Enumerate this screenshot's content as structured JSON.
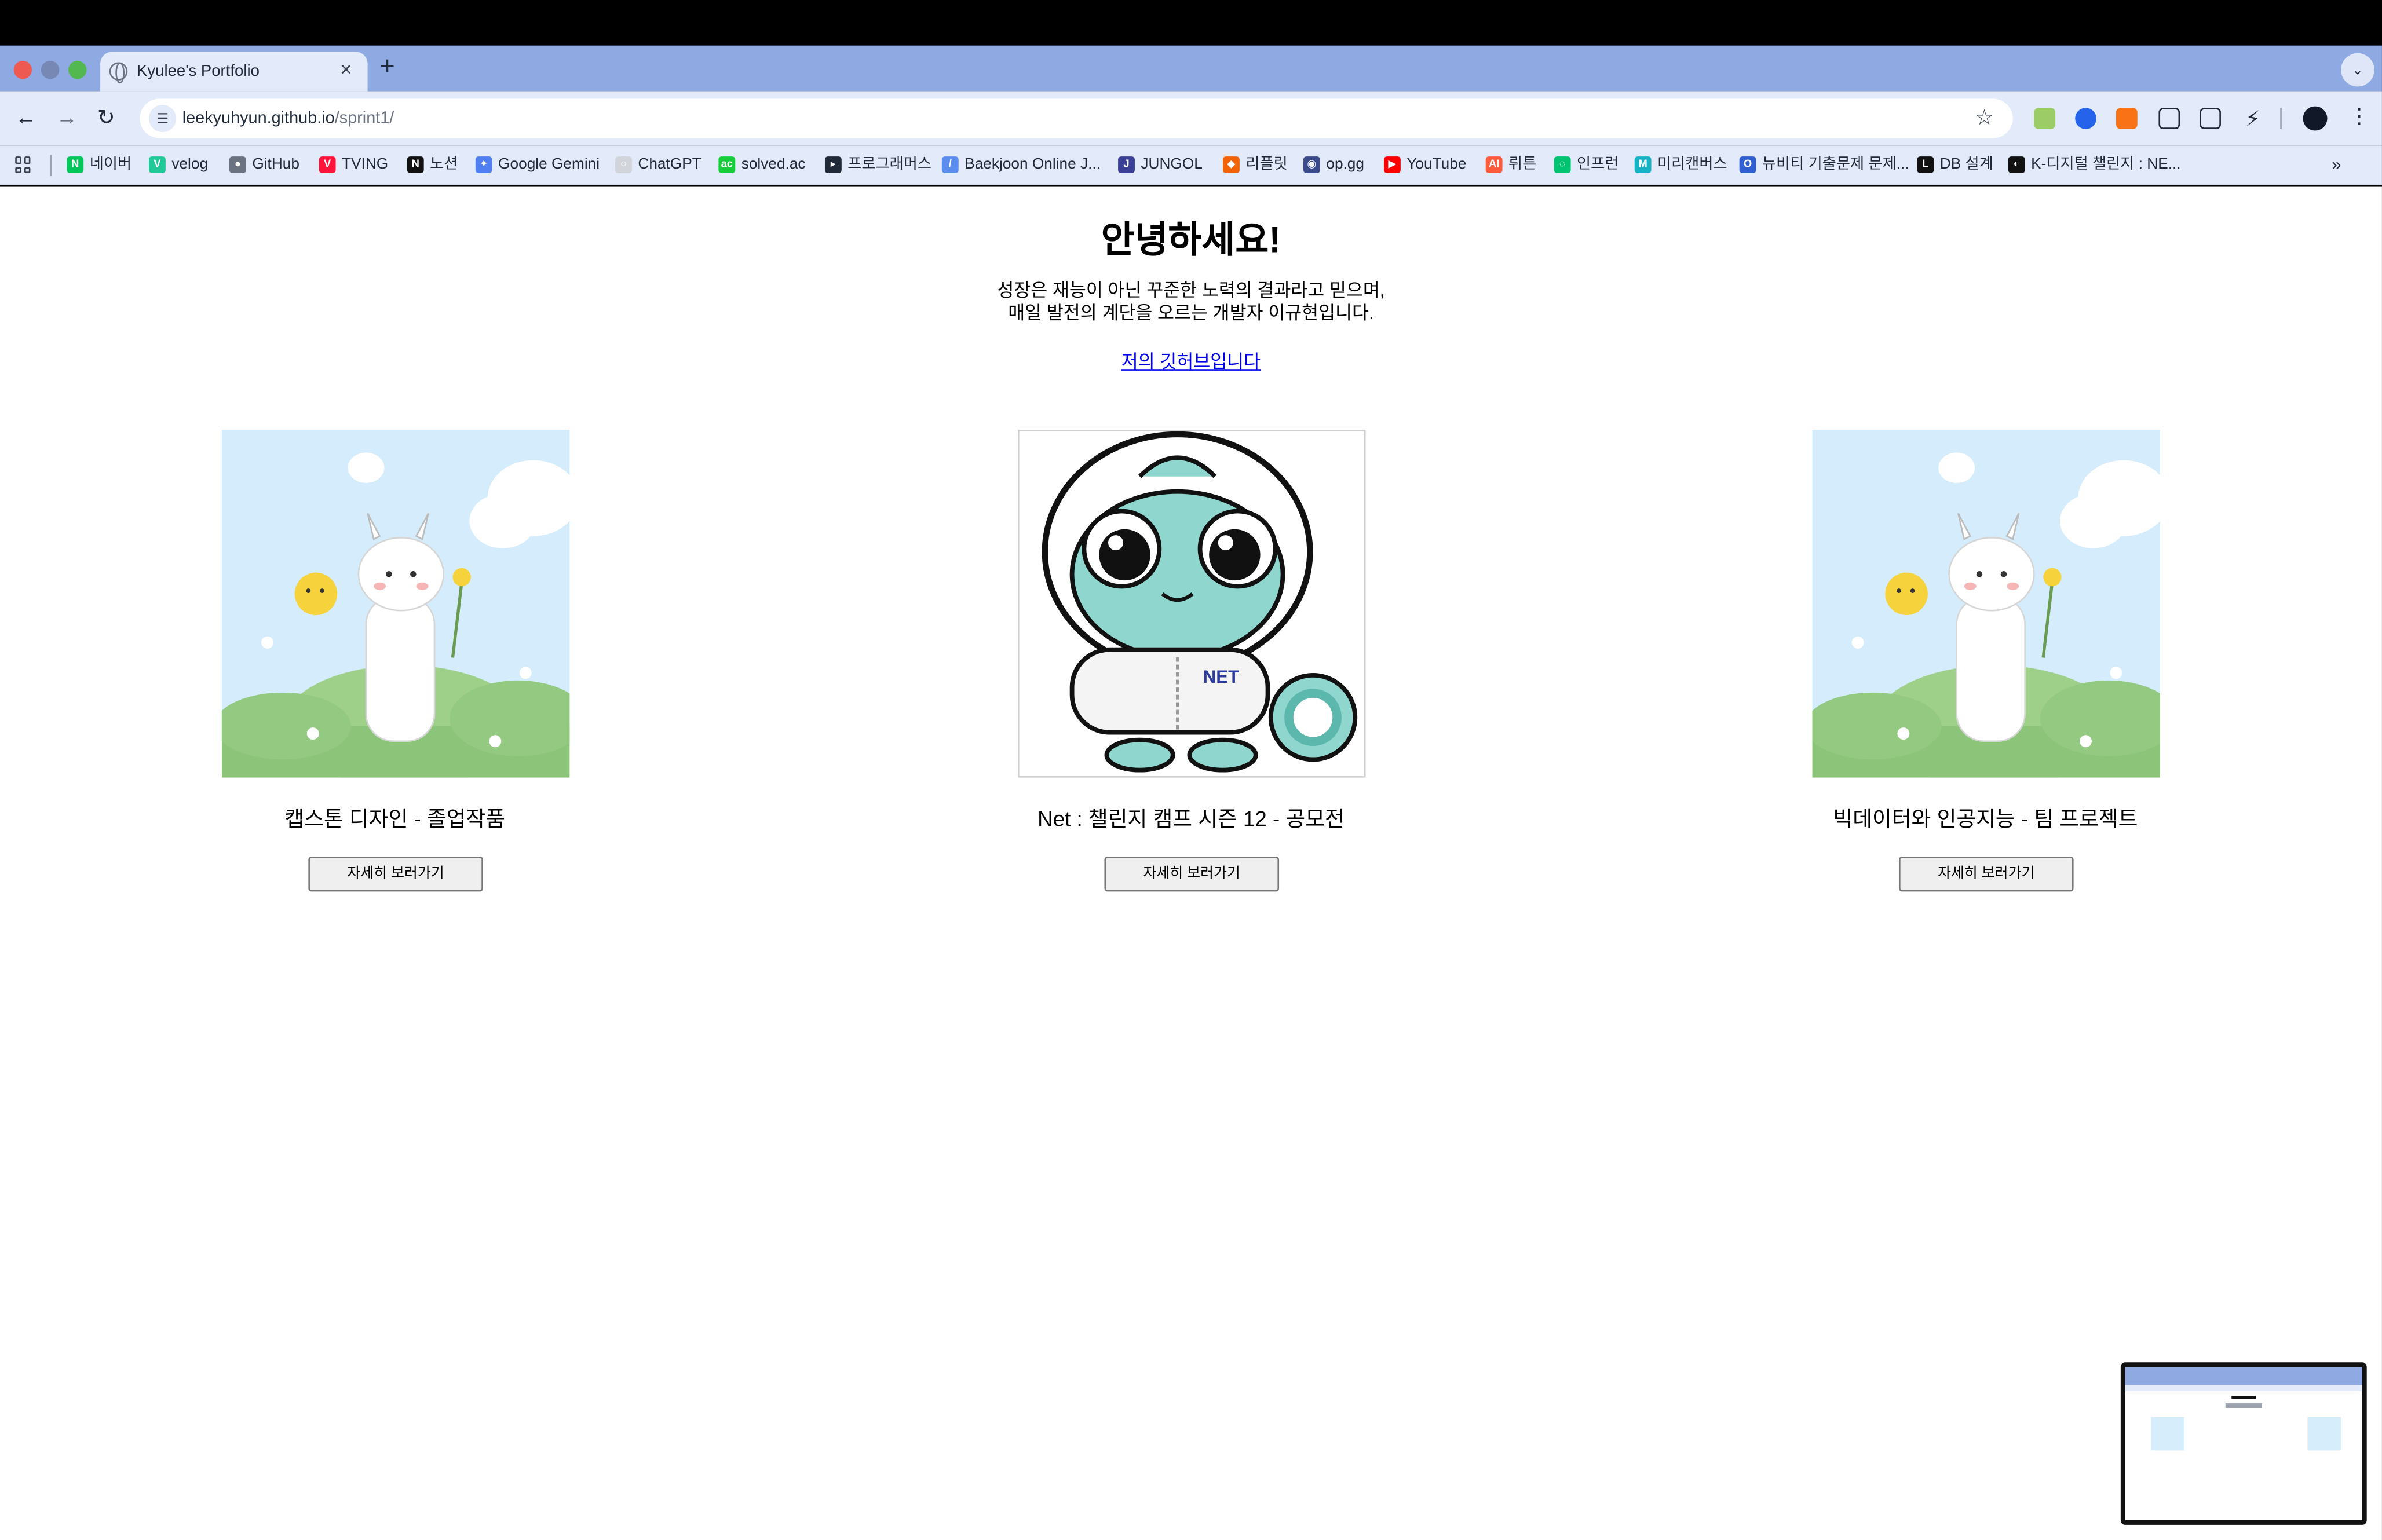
{
  "browser": {
    "tab_title": "Kyulee's Portfolio",
    "tab_close": "×",
    "new_tab": "+",
    "tab_search": "⌄",
    "url_host": "leekyuhyun.github.io",
    "url_path": "/sprint1/",
    "bookmarks": [
      {
        "label": "네이버",
        "color": "#03c75a",
        "glyph": "N"
      },
      {
        "label": "velog",
        "color": "#20c997",
        "glyph": "V"
      },
      {
        "label": "GitHub",
        "color": "#6b7280",
        "glyph": "●"
      },
      {
        "label": "TVING",
        "color": "#ff153c",
        "glyph": "V"
      },
      {
        "label": "노션",
        "color": "#111111",
        "glyph": "N"
      },
      {
        "label": "Google Gemini",
        "color": "#4f7ff0",
        "glyph": "✦"
      },
      {
        "label": "ChatGPT",
        "color": "#d1d5db",
        "glyph": "○"
      },
      {
        "label": "solved.ac",
        "color": "#17ce3a",
        "glyph": "ac"
      },
      {
        "label": "프로그래머스",
        "color": "#1f2937",
        "glyph": "▸"
      },
      {
        "label": "Baekjoon Online J...",
        "color": "#5b8def",
        "glyph": "/"
      },
      {
        "label": "JUNGOL",
        "color": "#3b3f98",
        "glyph": "J"
      },
      {
        "label": "리플릿",
        "color": "#f26207",
        "glyph": "◆"
      },
      {
        "label": "op.gg",
        "color": "#3b4a8a",
        "glyph": "◉"
      },
      {
        "label": "YouTube",
        "color": "#ff0000",
        "glyph": "▶"
      },
      {
        "label": "뤼튼",
        "color": "#ff5a3c",
        "glyph": "AI"
      },
      {
        "label": "인프런",
        "color": "#00c471",
        "glyph": "◌"
      },
      {
        "label": "미리캔버스",
        "color": "#18b2c7",
        "glyph": "M"
      },
      {
        "label": "뉴비티 기출문제 문제...",
        "color": "#2f5fd0",
        "glyph": "O"
      },
      {
        "label": "DB 설계",
        "color": "#111111",
        "glyph": "L"
      },
      {
        "label": "K-디지털 챌린지 : NE...",
        "color": "#111111",
        "glyph": "◐"
      }
    ],
    "bookmarks_more": "»"
  },
  "page": {
    "heading": "안녕하세요!",
    "intro_line1": "성장은 재능이 아닌 꾸준한 노력의 결과라고 믿으며,",
    "intro_line2": "매일 발전의 계단을 오르는 개발자 이규현입니다.",
    "github_link": "저의 깃허브입니다",
    "projects": [
      {
        "title": "캡스톤 디자인 - 졸업작품",
        "button": "자세히 보러가기",
        "image": "goat-illustration"
      },
      {
        "title": "Net : 챌린지 캠프 시즌 12 - 공모전",
        "button": "자세히 보러가기",
        "image": "chameleon-illustration"
      },
      {
        "title": "빅데이터와 인공지능 - 팀 프로젝트",
        "button": "자세히 보러가기",
        "image": "goat-illustration"
      }
    ],
    "net_logo": "NET"
  }
}
